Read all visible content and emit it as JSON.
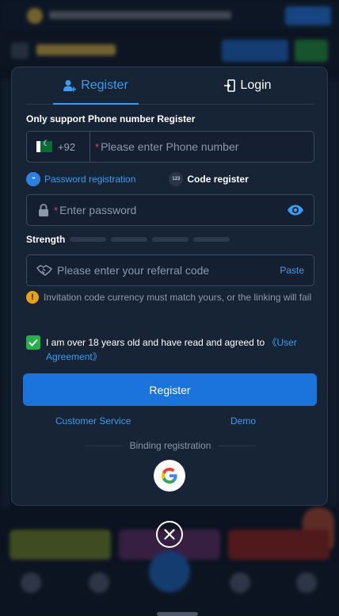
{
  "modal": {
    "tabs": [
      {
        "label": "Register",
        "icon": "add-user-icon",
        "active": true
      },
      {
        "label": "Login",
        "icon": "login-door-icon",
        "active": false
      }
    ],
    "notice": "Only support Phone number Register",
    "phone": {
      "country_code": "+92",
      "required_mark": "*",
      "placeholder": "Please enter Phone number"
    },
    "registration_options": {
      "password": "Password registration",
      "code": "Code register",
      "code_icon_text": "123",
      "password_icon_text": "**"
    },
    "password": {
      "required_mark": "*",
      "placeholder": "Enter password"
    },
    "strength": {
      "label": "Strength",
      "level": 0,
      "segments": 4
    },
    "referral": {
      "placeholder": "Please enter your referral code",
      "paste_label": "Paste"
    },
    "warning": {
      "text": "Invitation code currency must match yours, or the linking will fail"
    },
    "agreement": {
      "checked": true,
      "text": "I am over 18 years old and have read and agreed to ",
      "link": "《User Agreement》"
    },
    "register_button": "Register",
    "links": {
      "customer_service": "Customer Service",
      "demo": "Demo"
    },
    "binding_label": "Binding registration"
  },
  "colors": {
    "accent": "#3d9bf0",
    "button": "#1b74db",
    "modal_bg": "#172436",
    "checkbox": "#27b04a",
    "warning": "#e8a21a",
    "required": "#e0454f"
  }
}
